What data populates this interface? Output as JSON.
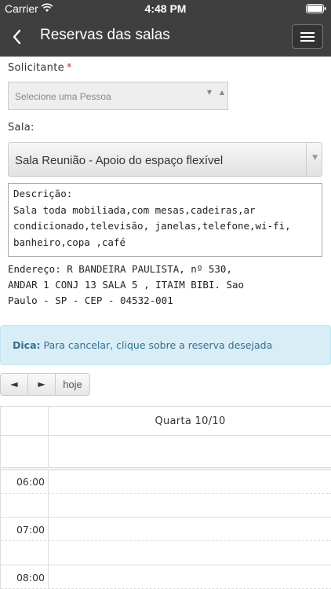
{
  "status_bar": {
    "carrier": "Carrier",
    "time": "4:48 PM"
  },
  "nav": {
    "title": "Reservas das salas"
  },
  "form": {
    "requester_label": "Solicitante",
    "required_marker": "*",
    "requester_placeholder": "Selecione uma Pessoa",
    "room_label": "Sala:",
    "room_value": "Sala Reunião - Apoio do espaço flexível",
    "description_lines": [
      "Descrição:",
      "Sala toda mobiliada,com mesas,cadeiras,ar",
      "condicionado,televisão, janelas,telefone,wi-fi,",
      "banheiro,copa ,café"
    ],
    "address_lines": [
      "Endereço: R BANDEIRA PAULISTA, nº 530,",
      "ANDAR 1 CONJ 13 SALA 5 , ITAIM BIBI. Sao",
      "Paulo - SP - CEP - 04532-001"
    ]
  },
  "tip": {
    "label": "Dica:",
    "text": "Para cancelar, clique sobre a reserva desejada"
  },
  "calendar": {
    "prev_label": "◄",
    "next_label": "►",
    "today_label": "hoje",
    "day_header": "Quarta 10/10",
    "times": [
      "06:00",
      "07:00",
      "08:00"
    ]
  },
  "colors": {
    "header_bg": "#3f3f3f",
    "tip_bg": "#d9edf7",
    "tip_text": "#31708f",
    "required": "#c0392b"
  }
}
